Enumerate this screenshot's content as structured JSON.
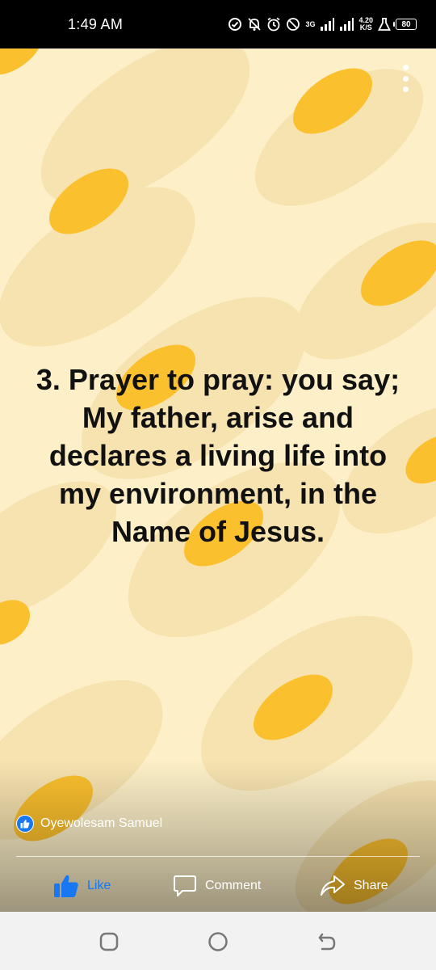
{
  "status_bar": {
    "time": "1:49 AM",
    "network_type": "3G",
    "net_speed_value": "4.20",
    "net_speed_unit": "K/S",
    "battery": "80"
  },
  "story": {
    "text_lines": [
      "3. Prayer to pray: you say;",
      "My father, arise and",
      "declares a living life into",
      "my environment, in the",
      "Name of Jesus."
    ],
    "background_color": "#fdf0c8",
    "accent_color": "#fbc02d"
  },
  "reactions": {
    "name": "Oyewolesam Samuel"
  },
  "actions": {
    "like_label": "Like",
    "comment_label": "Comment",
    "share_label": "Share",
    "like_color": "#1877f2"
  },
  "icons": {
    "status": [
      "sync-icon",
      "mute-icon",
      "alarm-icon",
      "dnd-icon",
      "signal-icon",
      "signal-icon",
      "lab-icon",
      "battery-icon"
    ],
    "nav": [
      "recent-apps-icon",
      "home-icon",
      "back-icon"
    ]
  }
}
